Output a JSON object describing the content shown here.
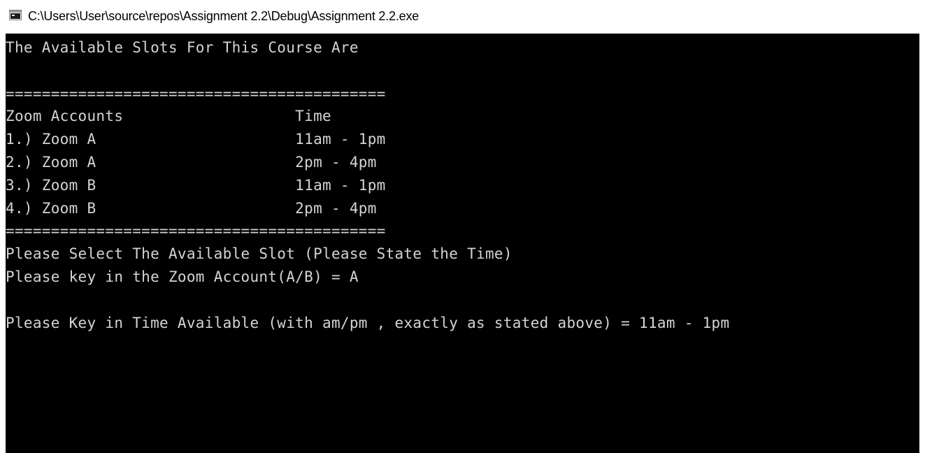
{
  "window": {
    "title": "C:\\Users\\User\\source\\repos\\Assignment 2.2\\Debug\\Assignment 2.2.exe",
    "icon": "console-app-icon"
  },
  "colors": {
    "console_background": "#000000",
    "console_text": "#d4d4d4",
    "titlebar_background": "#ffffff"
  },
  "console": {
    "lines": [
      "The Available Slots For This Course Are",
      "",
      "==========================================",
      "Zoom Accounts                   Time",
      "1.) Zoom A                      11am - 1pm",
      "2.) Zoom A                      2pm - 4pm",
      "3.) Zoom B                      11am - 1pm",
      "4.) Zoom B                      2pm - 4pm",
      "==========================================",
      "Please Select The Available Slot (Please State the Time)",
      "Please key in the Zoom Account(A/B) = A",
      "",
      "Please Key in Time Available (with am/pm , exactly as stated above) = 11am - 1pm"
    ]
  }
}
